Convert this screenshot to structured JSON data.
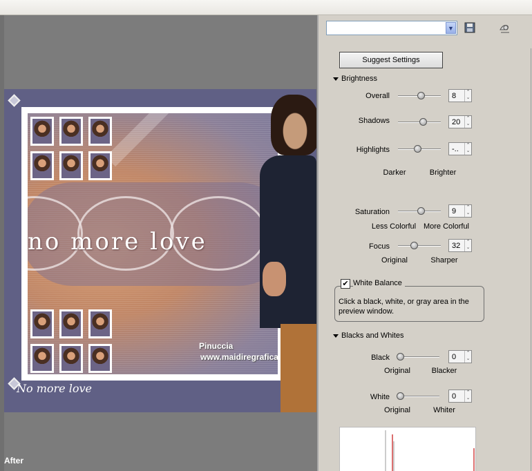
{
  "preview": {
    "after_label": "After",
    "artwork": {
      "title_text": "no more love",
      "watermark_name": "Pinuccia",
      "watermark_url": "www.maidiregrafica.eu",
      "caption": "No more love"
    }
  },
  "toolbar": {
    "preset_value": "",
    "help_label": "?"
  },
  "panel": {
    "suggest_button": "Suggest Settings",
    "brightness": {
      "heading": "Brightness",
      "overall": {
        "label": "Overall",
        "value": "8",
        "level": 0.55
      },
      "shadows": {
        "label": "Shadows",
        "value": "20",
        "level": 0.6
      },
      "highlights": {
        "label": "Highlights",
        "value": "-..",
        "level": 0.45
      },
      "darker_label": "Darker",
      "brighter_label": "Brighter"
    },
    "saturation": {
      "label": "Saturation",
      "value": "9",
      "level": 0.55,
      "less": "Less Colorful",
      "more": "More Colorful"
    },
    "focus": {
      "label": "Focus",
      "value": "32",
      "level": 0.35,
      "original": "Original",
      "sharper": "Sharper"
    },
    "white_balance": {
      "label": "White Balance",
      "checked": true,
      "hint": "Click a black, white, or gray area in the preview window."
    },
    "blacks_whites": {
      "heading": "Blacks and Whites",
      "black": {
        "label": "Black",
        "value": "0",
        "level": 0.0,
        "left": "Original",
        "right": "Blacker"
      },
      "white": {
        "label": "White",
        "value": "0",
        "level": 0.0,
        "left": "Original",
        "right": "Whiter"
      }
    }
  },
  "colors": {
    "preview_bg": "#7c7c7c",
    "art_frame": "#606085",
    "panel_bg": "#d4d0c8",
    "histogram_red": "#d04040"
  }
}
